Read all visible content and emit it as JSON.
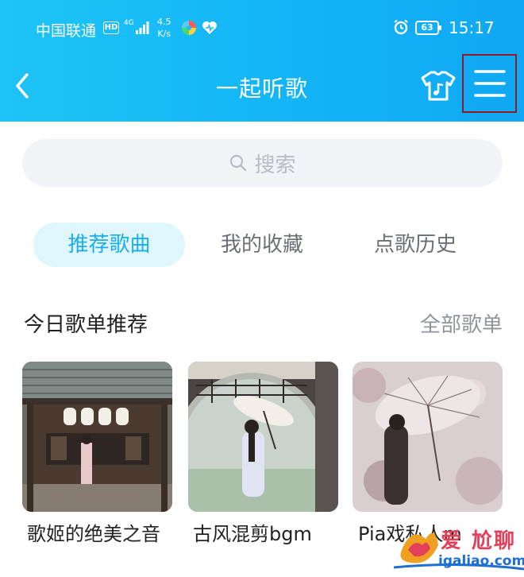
{
  "status_bar": {
    "carrier": "中国联通",
    "hd": "HD",
    "network": "4G",
    "speed_value": "4.5",
    "speed_unit": "K/s",
    "battery": "63",
    "time": "15:17"
  },
  "header": {
    "title": "一起听歌"
  },
  "search": {
    "placeholder": "搜索"
  },
  "tabs": [
    {
      "label": "推荐歌曲",
      "active": true
    },
    {
      "label": "我的收藏",
      "active": false
    },
    {
      "label": "点歌历史",
      "active": false
    }
  ],
  "section": {
    "title": "今日歌单推荐",
    "more": "全部歌单"
  },
  "playlists": [
    {
      "label": "歌姬的绝美之音"
    },
    {
      "label": "古风混剪bgm"
    },
    {
      "label": "Pia戏私人m"
    }
  ],
  "watermark": {
    "text": "爱 尬聊",
    "url": "igaliao.com"
  },
  "colors": {
    "header_start": "#1ec4f5",
    "header_end": "#0fa8f4",
    "active_tab_text": "#1aaee8",
    "active_tab_bg": "#e0f6fd",
    "highlight_box": "#8b1d2a"
  }
}
